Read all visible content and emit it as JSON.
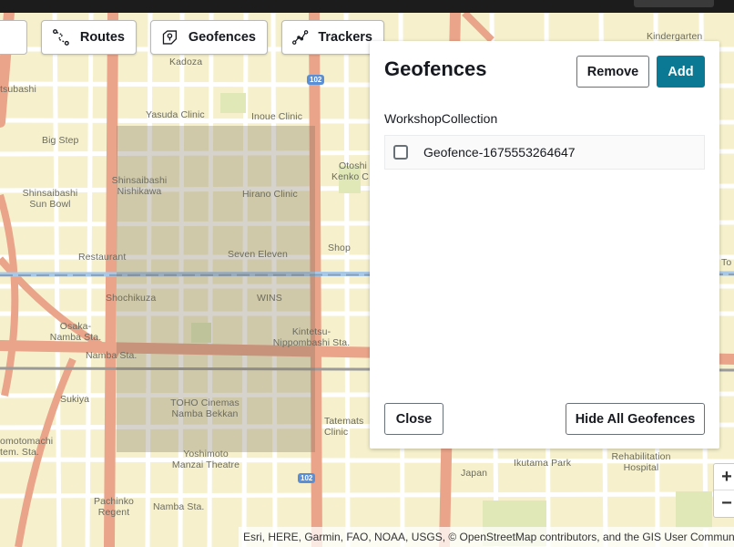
{
  "toolbar": {
    "routes_label": "Routes",
    "geofences_label": "Geofences",
    "trackers_label": "Trackers"
  },
  "panel": {
    "title": "Geofences",
    "remove_label": "Remove",
    "add_label": "Add",
    "collection_name": "WorkshopCollection",
    "items": [
      {
        "label": "Geofence-1675553264647",
        "checked": false
      }
    ],
    "close_label": "Close",
    "hide_all_label": "Hide All Geofences"
  },
  "map": {
    "labels": [
      "Kadoza",
      "Kindergarten",
      "tsubashi",
      "Yasuda Clinic",
      "Inoue Clinic",
      "Big Step",
      "Otoshi",
      "Kenko C",
      "Shinsaibashi Nishikawa",
      "Shinsaibashi Sun Bowl",
      "Hirano Clinic",
      "Seven Eleven",
      "Shop",
      "Restaurant",
      "Shochikuza",
      "WINS",
      "Osaka-Namba Sta.",
      "Kintetsu-Nippombashi Sta.",
      "Namba Sta.",
      "Sukiya",
      "TOHO Cinemas Namba Bekkan",
      "Tatemats Clinic",
      "omotomachi",
      "tem. Sta.",
      "Yoshimoto Manzai Theatre",
      "Japan",
      "Ikutama Park",
      "Rehabilitation Hospital",
      "Pachinko Regent",
      "To"
    ],
    "highway_102": "102",
    "attribution": "Esri, HERE, Garmin, FAO, NOAA, USGS, © OpenStreetMap contributors, and the GIS User Community"
  },
  "zoom": {
    "in": "+",
    "out": "−"
  },
  "colors": {
    "primary_button": "#0b7994",
    "map_background": "#f6f1cc",
    "major_road": "#eaa48a",
    "geofence_fill": "#786e5a"
  }
}
